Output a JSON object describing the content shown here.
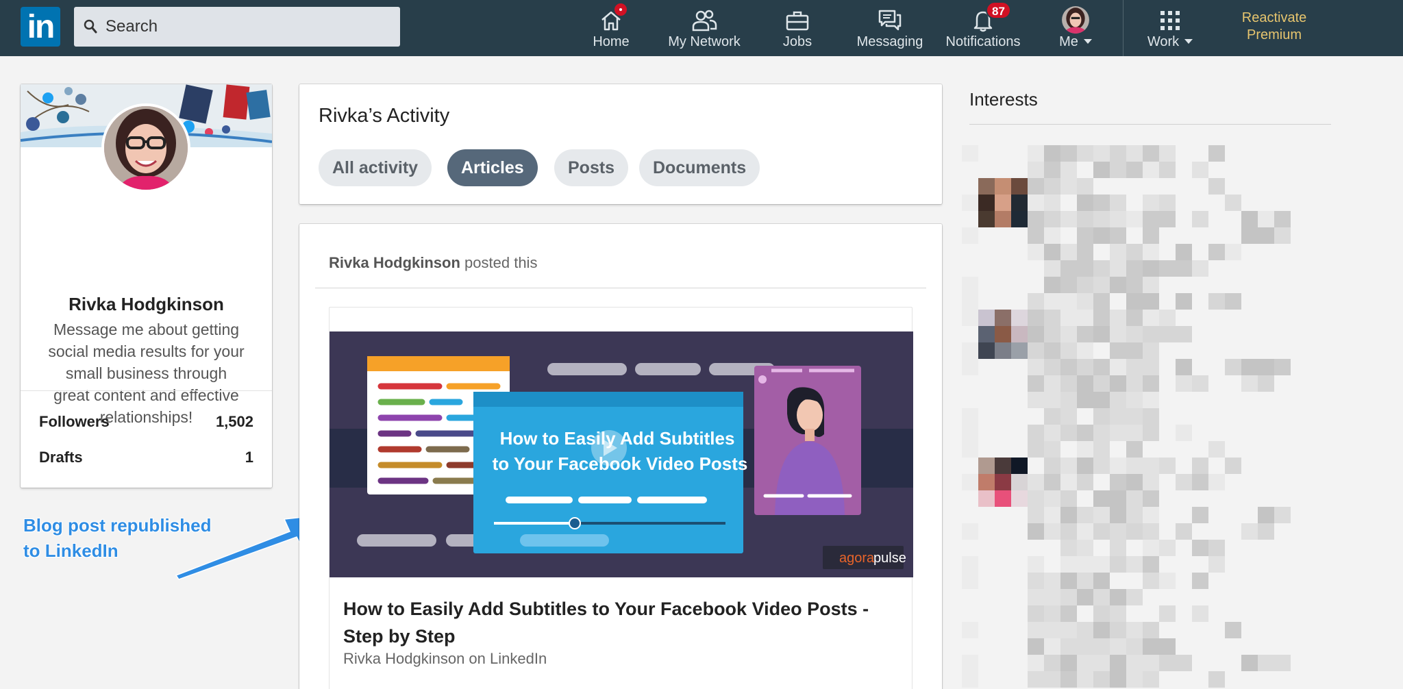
{
  "nav": {
    "logo_text": "in",
    "search_placeholder": "Search",
    "items": [
      {
        "label": "Home",
        "icon": "home-icon"
      },
      {
        "label": "My Network",
        "icon": "people-icon"
      },
      {
        "label": "Jobs",
        "icon": "briefcase-icon"
      },
      {
        "label": "Messaging",
        "icon": "chat-icon"
      },
      {
        "label": "Notifications",
        "icon": "bell-icon",
        "badge": "87"
      },
      {
        "label": "Me",
        "icon": "avatar"
      },
      {
        "label": "Work",
        "icon": "grid-icon"
      }
    ],
    "premium": [
      "Reactivate",
      "Premium"
    ]
  },
  "profile": {
    "name": "Rivka Hodgkinson",
    "bio": "Message me about getting social media results for your small business through great content and effective relationships!",
    "stats": [
      {
        "label": "Followers",
        "value": "1,502"
      },
      {
        "label": "Drafts",
        "value": "1"
      }
    ]
  },
  "annotation": {
    "lines": [
      "Blog post republished",
      "to LinkedIn"
    ],
    "color": "#2f8de4"
  },
  "activity": {
    "title": "Rivka’s Activity",
    "tabs": [
      {
        "label": "All activity",
        "active": false
      },
      {
        "label": "Articles",
        "active": true
      },
      {
        "label": "Posts",
        "active": false
      },
      {
        "label": "Documents",
        "active": false
      }
    ]
  },
  "post": {
    "author": "Rivka Hodgkinson",
    "action": "posted this",
    "thumbnail": {
      "headline_1": "How to Easily Add Subtitles",
      "headline_2": "to Your Facebook Video Posts",
      "brand_1": "agora",
      "brand_2": "pulse"
    },
    "article_title": "How to Easily Add Subtitles to Your Facebook Video Posts - Step by Step",
    "article_byline": "Rivka Hodgkinson on LinkedIn"
  },
  "interests": {
    "title": "Interests"
  },
  "colors": {
    "nav_bg": "#283e4a",
    "linkedin_blue": "#0073b1",
    "premium_gold": "#e7c56e",
    "active_pill": "#56687a"
  }
}
